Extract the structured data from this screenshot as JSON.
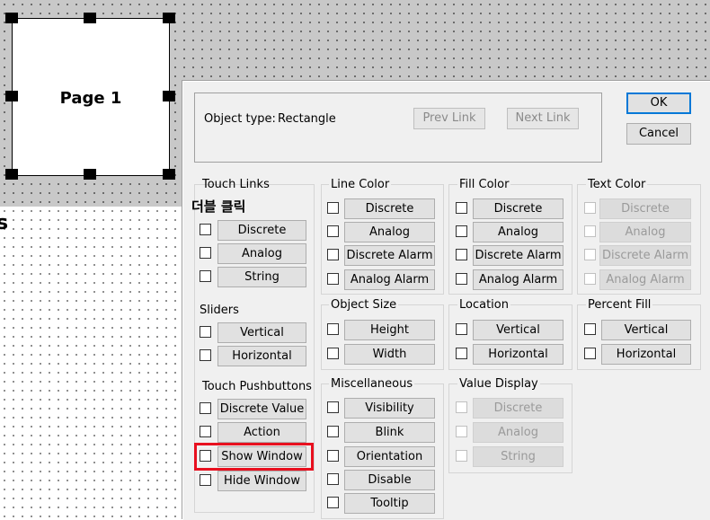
{
  "page_object": {
    "label": "Page 1"
  },
  "left_fragment": "s",
  "annotation": {
    "text": "더블 클릭",
    "highlight_color": "#e8101f"
  },
  "dialog": {
    "object_type_label": "Object type:",
    "object_type_value": "Rectangle",
    "prev_link": "Prev Link",
    "next_link": "Next Link",
    "ok": "OK",
    "cancel": "Cancel",
    "groups": {
      "touch_links": {
        "title": "Touch Links",
        "items": [
          "Discrete",
          "Analog",
          "String"
        ]
      },
      "sliders": {
        "title": "Sliders",
        "items": [
          "Vertical",
          "Horizontal"
        ]
      },
      "touch_pushbuttons": {
        "title": "Touch Pushbuttons",
        "items": [
          "Discrete Value",
          "Action",
          "Show Window",
          "Hide Window"
        ]
      },
      "line_color": {
        "title": "Line Color",
        "items": [
          "Discrete",
          "Analog",
          "Discrete Alarm",
          "Analog Alarm"
        ]
      },
      "fill_color": {
        "title": "Fill Color",
        "items": [
          "Discrete",
          "Analog",
          "Discrete Alarm",
          "Analog Alarm"
        ]
      },
      "text_color": {
        "title": "Text Color",
        "items": [
          "Discrete",
          "Analog",
          "Discrete Alarm",
          "Analog Alarm"
        ]
      },
      "object_size": {
        "title": "Object Size",
        "items": [
          "Height",
          "Width"
        ]
      },
      "location": {
        "title": "Location",
        "items": [
          "Vertical",
          "Horizontal"
        ]
      },
      "percent_fill": {
        "title": "Percent Fill",
        "items": [
          "Vertical",
          "Horizontal"
        ]
      },
      "miscellaneous": {
        "title": "Miscellaneous",
        "items": [
          "Visibility",
          "Blink",
          "Orientation",
          "Disable",
          "Tooltip"
        ]
      },
      "value_display": {
        "title": "Value Display",
        "items": [
          "Discrete",
          "Analog",
          "String"
        ]
      }
    }
  }
}
